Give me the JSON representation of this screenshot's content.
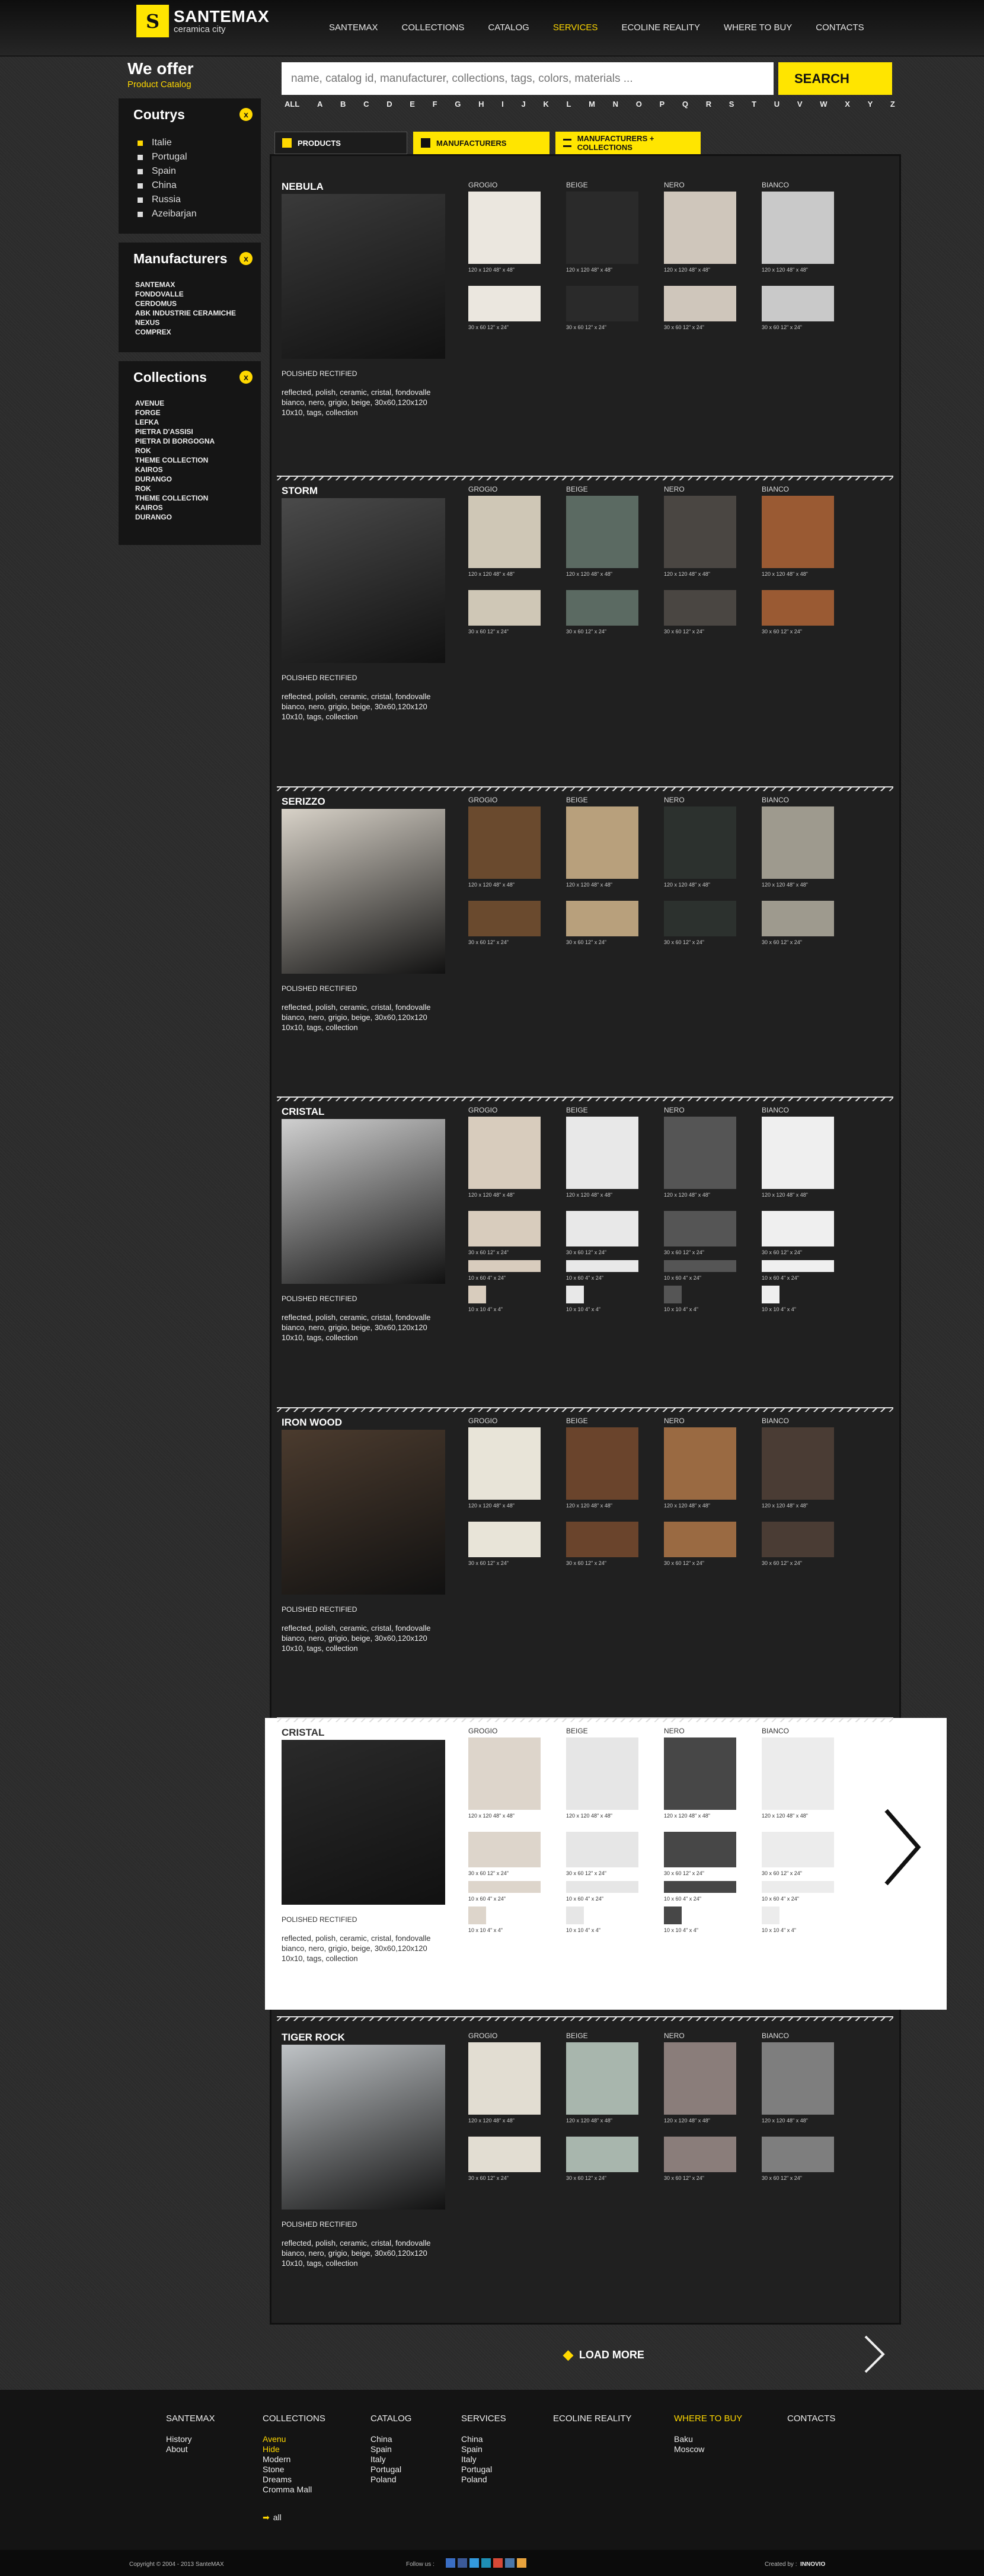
{
  "header": {
    "logo_letter": "S",
    "logo_title": "SANTEMAX",
    "logo_sub": "ceramica city",
    "nav": [
      "SANTEMAX",
      "COLLECTIONS",
      "CATALOG",
      "SERVICES",
      "ECOLINE REALITY",
      "WHERE TO BUY",
      "CONTACTS"
    ],
    "active": "SERVICES"
  },
  "left": {
    "title": "We offer",
    "subtitle": "Product Catalog",
    "countries_title": "Coutrys",
    "countries": [
      "Italie",
      "Portugal",
      "Spain",
      "China",
      "Russia",
      "Azeibarjan"
    ],
    "manufacturers_title": "Manufacturers",
    "manufacturers": [
      "SANTEMAX",
      "FONDOVALLE",
      "CERDOMUS",
      "ABK INDUSTRIE CERAMICHE",
      "NEXUS",
      "COMPREX"
    ],
    "collections_title": "Collections",
    "collections": [
      "AVENUE",
      "FORGE",
      "LEFKA",
      "PIETRA D'ASSISI",
      "PIETRA DI BORGOGNA",
      "ROK",
      "THEME COLLECTION",
      "KAIROS",
      "DURANGO",
      "ROK",
      "THEME COLLECTION",
      "KAIROS",
      "DURANGO"
    ],
    "close_icon": "x"
  },
  "search": {
    "placeholder": "name, catalog id, manufacturer, collections, tags, colors, materials ...",
    "button": "SEARCH"
  },
  "alphabet": [
    "ALL",
    "A",
    "B",
    "C",
    "D",
    "E",
    "F",
    "G",
    "H",
    "I",
    "J",
    "K",
    "L",
    "M",
    "N",
    "O",
    "P",
    "Q",
    "R",
    "S",
    "T",
    "U",
    "V",
    "W",
    "X",
    "Y",
    "Z"
  ],
  "tabs": [
    "PRODUCTS",
    "MANUFACTURERS",
    "MANUFACTURERS + COLLECTIONS"
  ],
  "colors": [
    "GROGIO",
    "BEIGE",
    "NERO",
    "BIANCO"
  ],
  "finish": "POLISHED RECTIFIED",
  "tags": "reflected, polish, ceramic, cristal, fondovalle bianco, nero, grigio, beige, 30x60,120x120 10x10, tags, collection",
  "cap1": "120 x 120  48\" x 48\"",
  "cap2": "30 x 60  12\" x 24\"",
  "cap3": "10 x 60  4\" x 24\"",
  "cap4": "10 x 10  4\" x 4\"",
  "products": [
    {
      "name": "NEBULA"
    },
    {
      "name": "STORM"
    },
    {
      "name": "SERIZZO"
    },
    {
      "name": "CRISTAL"
    },
    {
      "name": "IRON WOOD"
    },
    {
      "name": "CRISTAL"
    },
    {
      "name": "TIGER ROCK"
    }
  ],
  "load_more": "LOAD MORE",
  "footer": {
    "cols": [
      {
        "title": "SANTEMAX",
        "items": [
          "History",
          "About"
        ]
      },
      {
        "title": "COLLECTIONS",
        "items": [
          "Avenu",
          "Hide",
          "Modern",
          "Stone",
          "Dreams",
          "Cromma Mall"
        ],
        "extra": "all"
      },
      {
        "title": "CATALOG",
        "items": [
          "China",
          "Spain",
          "Italy",
          "Portugal",
          "Poland"
        ]
      },
      {
        "title": "SERVICES",
        "items": [
          "China",
          "Spain",
          "Italy",
          "Portugal",
          "Poland"
        ]
      },
      {
        "title": "ECOLINE REALITY",
        "items": []
      },
      {
        "title": "WHERE TO BUY",
        "items": [
          "Baku",
          "Moscow"
        ]
      },
      {
        "title": "CONTACTS",
        "items": []
      }
    ],
    "copyright": "Copyright © 2004 - 2013  SanteMAX",
    "follow": "Follow us :",
    "created": "Created by :",
    "creator": "INNOVIO",
    "accent": "#ffd800"
  }
}
